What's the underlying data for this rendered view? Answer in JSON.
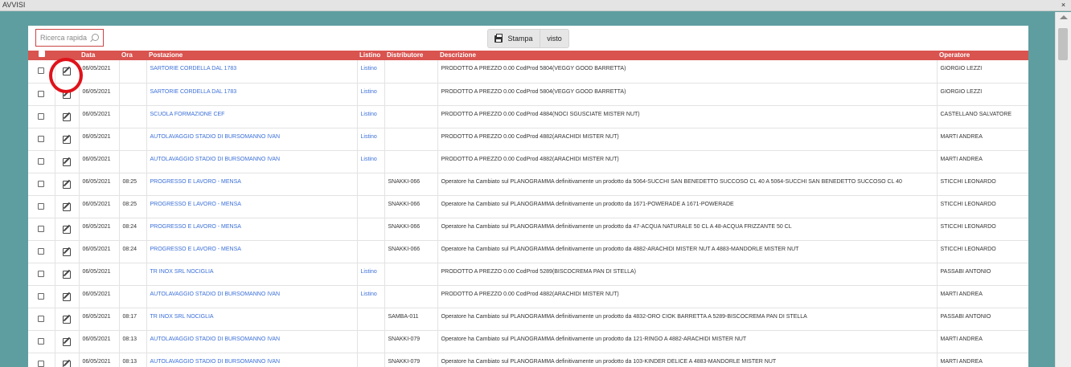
{
  "window": {
    "title": "AVVISI",
    "close_glyph": "×"
  },
  "search": {
    "placeholder": "Ricerca rapida"
  },
  "toolbar": {
    "print_label": "Stampa",
    "seen_label": "visto"
  },
  "table": {
    "headers": {
      "data": "Data",
      "ora": "Ora",
      "postazione": "Postazione",
      "listino": "Listino",
      "distributore": "Distributore",
      "descrizione": "Descrizione",
      "operatore": "Operatore"
    },
    "rows": [
      {
        "data": "06/05/2021",
        "ora": "",
        "postazione": "SARTORIE CORDELLA DAL 1783",
        "listino": "Listino",
        "distributore": "",
        "descrizione": "PRODOTTO A PREZZO 0.00 CodProd 5804(VEGGY GOOD BARRETTA)",
        "operatore": "GIORGIO LEZZI"
      },
      {
        "data": "06/05/2021",
        "ora": "",
        "postazione": "SARTORIE CORDELLA DAL 1783",
        "listino": "Listino",
        "distributore": "",
        "descrizione": "PRODOTTO A PREZZO 0.00 CodProd 5804(VEGGY GOOD BARRETTA)",
        "operatore": "GIORGIO LEZZI"
      },
      {
        "data": "06/05/2021",
        "ora": "",
        "postazione": "SCUOLA FORMAZIONE CEF",
        "listino": "Listino",
        "distributore": "",
        "descrizione": "PRODOTTO A PREZZO 0.00 CodProd 4884(NOCI SGUSCIATE MISTER NUT)",
        "operatore": "CASTELLANO SALVATORE"
      },
      {
        "data": "06/05/2021",
        "ora": "",
        "postazione": "AUTOLAVAGGIO STADIO DI BURSOMANNO IVAN",
        "listino": "Listino",
        "distributore": "",
        "descrizione": "PRODOTTO A PREZZO 0.00 CodProd 4882(ARACHIDI MISTER NUT)",
        "operatore": "MARTI ANDREA"
      },
      {
        "data": "06/05/2021",
        "ora": "",
        "postazione": "AUTOLAVAGGIO STADIO DI BURSOMANNO IVAN",
        "listino": "Listino",
        "distributore": "",
        "descrizione": "PRODOTTO A PREZZO 0.00 CodProd 4882(ARACHIDI MISTER NUT)",
        "operatore": "MARTI ANDREA"
      },
      {
        "data": "06/05/2021",
        "ora": "08:25",
        "postazione": "PROGRESSO E LAVORO - MENSA",
        "listino": "",
        "distributore": "SNAKKI-066",
        "descrizione": "Operatore ha Cambiato sul PLANOGRAMMA definitivamente un prodotto da 5064-SUCCHI SAN BENEDETTO SUCCOSO CL 40 A 5064-SUCCHI SAN BENEDETTO SUCCOSO CL 40",
        "operatore": "STICCHI LEONARDO"
      },
      {
        "data": "06/05/2021",
        "ora": "08:25",
        "postazione": "PROGRESSO E LAVORO - MENSA",
        "listino": "",
        "distributore": "SNAKKI-066",
        "descrizione": "Operatore ha Cambiato sul PLANOGRAMMA definitivamente un prodotto da 1671-POWERADE A 1671-POWERADE",
        "operatore": "STICCHI LEONARDO"
      },
      {
        "data": "06/05/2021",
        "ora": "08:24",
        "postazione": "PROGRESSO E LAVORO - MENSA",
        "listino": "",
        "distributore": "SNAKKI-066",
        "descrizione": "Operatore ha Cambiato sul PLANOGRAMMA definitivamente un prodotto da 47-ACQUA NATURALE 50 CL A 48-ACQUA FRIZZANTE 50 CL",
        "operatore": "STICCHI LEONARDO"
      },
      {
        "data": "06/05/2021",
        "ora": "08:24",
        "postazione": "PROGRESSO E LAVORO - MENSA",
        "listino": "",
        "distributore": "SNAKKI-066",
        "descrizione": "Operatore ha Cambiato sul PLANOGRAMMA definitivamente un prodotto da 4882-ARACHIDI MISTER NUT A 4883-MANDORLE MISTER NUT",
        "operatore": "STICCHI LEONARDO"
      },
      {
        "data": "06/05/2021",
        "ora": "",
        "postazione": "TR INOX SRL NOCIGLIA",
        "listino": "Listino",
        "distributore": "",
        "descrizione": "PRODOTTO A PREZZO 0.00 CodProd 5289(BISCOCREMA PAN DI STELLA)",
        "operatore": "PASSABI ANTONIO"
      },
      {
        "data": "06/05/2021",
        "ora": "",
        "postazione": "AUTOLAVAGGIO STADIO DI BURSOMANNO IVAN",
        "listino": "Listino",
        "distributore": "",
        "descrizione": "PRODOTTO A PREZZO 0.00 CodProd 4882(ARACHIDI MISTER NUT)",
        "operatore": "MARTI ANDREA"
      },
      {
        "data": "06/05/2021",
        "ora": "08:17",
        "postazione": "TR INOX SRL NOCIGLIA",
        "listino": "",
        "distributore": "SAMBA-011",
        "descrizione": "Operatore ha Cambiato sul PLANOGRAMMA definitivamente un prodotto da 4832-ORO CIOK BARRETTA A 5289-BISCOCREMA PAN DI STELLA",
        "operatore": "PASSABI ANTONIO"
      },
      {
        "data": "06/05/2021",
        "ora": "08:13",
        "postazione": "AUTOLAVAGGIO STADIO DI BURSOMANNO IVAN",
        "listino": "",
        "distributore": "SNAKKI-079",
        "descrizione": "Operatore ha Cambiato sul PLANOGRAMMA definitivamente un prodotto da 121-RINGO A 4882-ARACHIDI MISTER NUT",
        "operatore": "MARTI ANDREA"
      },
      {
        "data": "06/05/2021",
        "ora": "08:13",
        "postazione": "AUTOLAVAGGIO STADIO DI BURSOMANNO IVAN",
        "listino": "",
        "distributore": "SNAKKI-079",
        "descrizione": "Operatore ha Cambiato sul PLANOGRAMMA definitivamente un prodotto da 103-KINDER DELICE A 4883-MANDORLE MISTER NUT",
        "operatore": "MARTI ANDREA"
      }
    ]
  },
  "colors": {
    "background": "#5f9ea0",
    "header": "#d9534f",
    "link": "#3a6fd8",
    "highlight": "#e0121a"
  },
  "icons": {
    "row_edit": "edit-icon",
    "search": "search-icon",
    "print": "printer-icon",
    "close": "close-icon"
  }
}
